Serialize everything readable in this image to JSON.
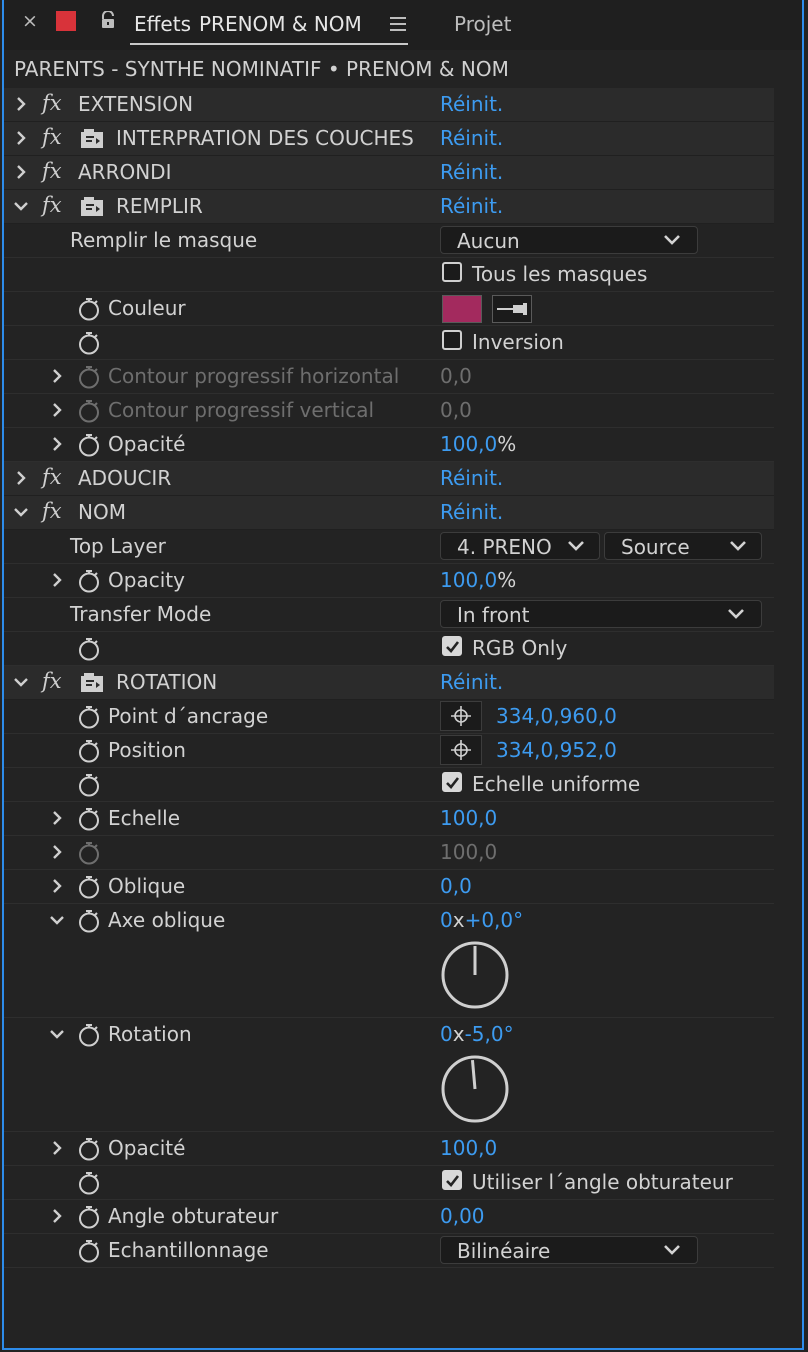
{
  "tabbar": {
    "close": "×",
    "tab_title": "Effets",
    "comp_name": "PRENOM & NOM",
    "other_tab": "Projet",
    "label_color": "#d8333a"
  },
  "breadcrumb": "PARENTS - SYNTHE NOMINATIF • PRENOM & NOM",
  "reset_label": "Réinit.",
  "effects": {
    "extension": "EXTENSION",
    "interp": "INTERPRATION DES COUCHES",
    "arrondi": "ARRONDI",
    "remplir": {
      "name": "REMPLIR",
      "mask_label": "Remplir le masque",
      "mask_value": "Aucun",
      "all_masks": "Tous les masques",
      "color_label": "Couleur",
      "color_value": "#a32a5e",
      "inversion": "Inversion",
      "feather_h": "Contour progressif horizontal",
      "feather_h_value": "0,0",
      "feather_v": "Contour progressif vertical",
      "feather_v_value": "0,0",
      "opacity_label": "Opacité",
      "opacity_value": "100,0",
      "opacity_unit": "%"
    },
    "adoucir": "ADOUCIR",
    "nom": {
      "name": "NOM",
      "top_layer_label": "Top Layer",
      "top_layer_value": "4. PRENO",
      "top_layer_source": "Source",
      "opacity_label": "Opacity",
      "opacity_value": "100,0",
      "opacity_unit": "%",
      "transfer_label": "Transfer Mode",
      "transfer_value": "In front",
      "rgb_only": "RGB Only"
    },
    "rotation": {
      "name": "ROTATION",
      "anchor_label": "Point d´ancrage",
      "anchor_value": "334,0,960,0",
      "position_label": "Position",
      "position_value": "334,0,952,0",
      "uniform_scale": "Echelle uniforme",
      "scale_label": "Echelle",
      "scale_value": "100,0",
      "scale2_value": "100,0",
      "skew_label": "Oblique",
      "skew_value": "0,0",
      "skew_axis_label": "Axe oblique",
      "skew_axis_rev": "0",
      "skew_axis_x": "x",
      "skew_axis_deg": "+0,0°",
      "skew_axis_angle": 0,
      "rotation_label": "Rotation",
      "rotation_rev": "0",
      "rotation_x": "x",
      "rotation_deg": "-5,0°",
      "rotation_angle": -5,
      "opacity_label": "Opacité",
      "opacity_value": "100,0",
      "shutter_use": "Utiliser l´angle obturateur",
      "shutter_label": "Angle obturateur",
      "shutter_value": "0,00",
      "sampling_label": "Echantillonnage",
      "sampling_value": "Bilinéaire"
    }
  }
}
